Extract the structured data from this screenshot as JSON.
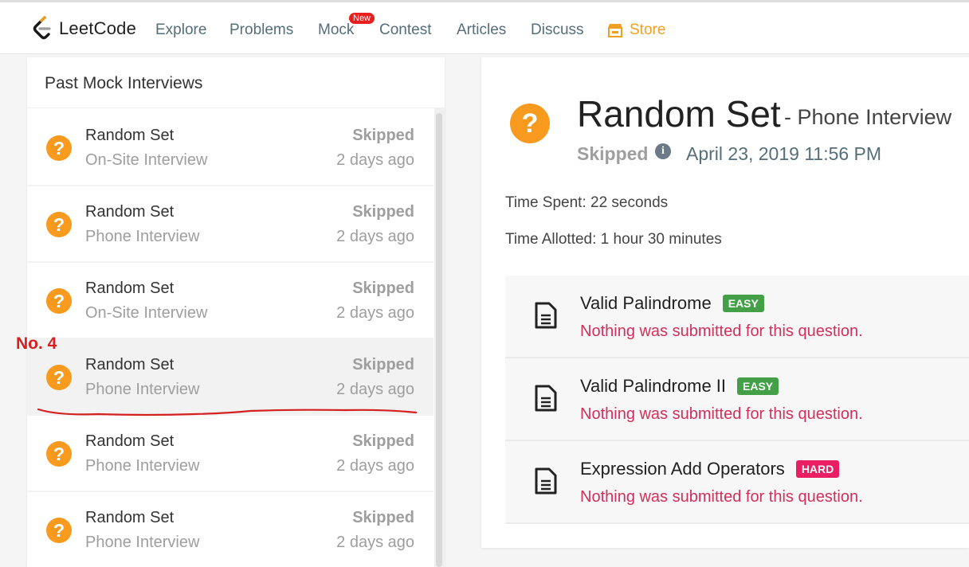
{
  "nav": {
    "logo_text": "LeetCode",
    "items": [
      "Explore",
      "Problems",
      "Mock",
      "Contest",
      "Articles",
      "Discuss"
    ],
    "new_badge": "New",
    "store": "Store",
    "colors": {
      "store": "#f0a020",
      "new_badge": "#e91e1e"
    }
  },
  "sidebar": {
    "title": "Past Mock Interviews",
    "items": [
      {
        "title": "Random Set",
        "type": "On-Site Interview",
        "status": "Skipped",
        "time": "2 days ago"
      },
      {
        "title": "Random Set",
        "type": "Phone Interview",
        "status": "Skipped",
        "time": "2 days ago"
      },
      {
        "title": "Random Set",
        "type": "On-Site Interview",
        "status": "Skipped",
        "time": "2 days ago"
      },
      {
        "title": "Random Set",
        "type": "Phone Interview",
        "status": "Skipped",
        "time": "2 days ago"
      },
      {
        "title": "Random Set",
        "type": "Phone Interview",
        "status": "Skipped",
        "time": "2 days ago"
      },
      {
        "title": "Random Set",
        "type": "Phone Interview",
        "status": "Skipped",
        "time": "2 days ago"
      }
    ]
  },
  "annotation": {
    "label": "No. 4",
    "color": "#d62020"
  },
  "detail": {
    "title": "Random Set",
    "type": "- Phone Interview",
    "status": "Skipped",
    "date": "April 23, 2019 11:56 PM",
    "time_spent": "Time Spent: 22 seconds",
    "time_allotted": "Time Allotted: 1 hour 30 minutes",
    "questions": [
      {
        "name": "Valid Palindrome",
        "difficulty": "EASY",
        "color": "#43a047",
        "note": "Nothing was submitted for this question."
      },
      {
        "name": "Valid Palindrome II",
        "difficulty": "EASY",
        "color": "#43a047",
        "note": "Nothing was submitted for this question."
      },
      {
        "name": "Expression Add Operators",
        "difficulty": "HARD",
        "color": "#e91e63",
        "note": "Nothing was submitted for this question."
      }
    ]
  },
  "icons": {
    "status": "question-mark-icon",
    "info": "info-icon",
    "question": "document-icon",
    "store": "store-icon"
  }
}
